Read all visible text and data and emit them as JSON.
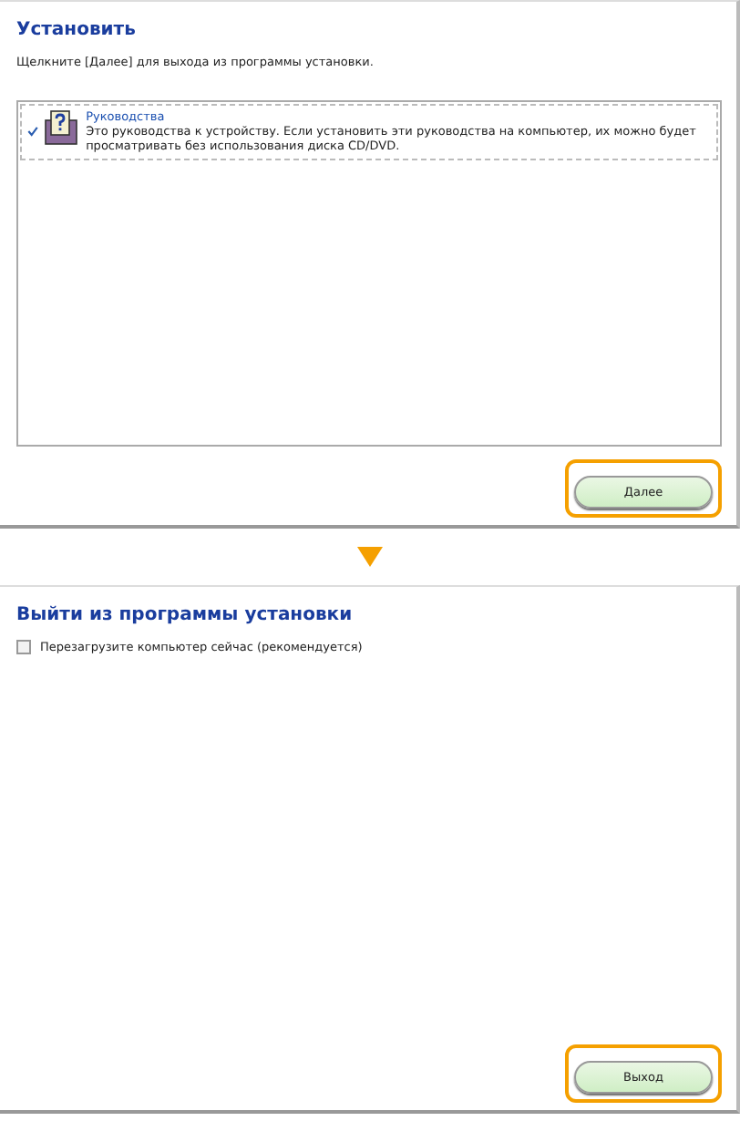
{
  "screens": [
    {
      "title": "Установить",
      "instruction": "Щелкните [Далее] для выхода из программы установки.",
      "items": [
        {
          "name": "Руководства",
          "description": "Это руководства к устройству. Если установить эти руководства на компьютер, их можно будет просматривать без использования диска CD/DVD.",
          "checked": true
        }
      ],
      "button": {
        "label": "Далее",
        "highlighted": true
      }
    },
    {
      "title": "Выйти из программы установки",
      "option": {
        "label": "Перезагрузите компьютер сейчас (рекомендуется)",
        "checked": false
      },
      "button": {
        "label": "Выход",
        "highlighted": true
      }
    }
  ]
}
